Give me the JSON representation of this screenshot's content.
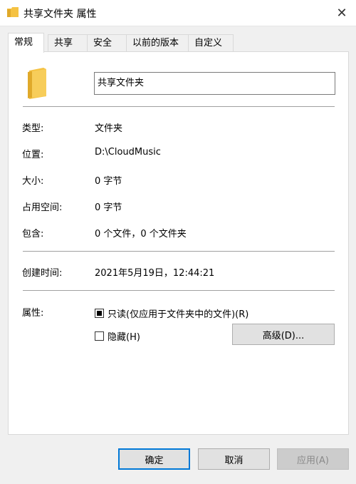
{
  "window": {
    "title": "共享文件夹 属性",
    "close_symbol": "✕"
  },
  "tabs": [
    {
      "label": "常规",
      "active": true
    },
    {
      "label": "共享"
    },
    {
      "label": "安全"
    },
    {
      "label": "以前的版本"
    },
    {
      "label": "自定义"
    }
  ],
  "general": {
    "folder_name": "共享文件夹",
    "rows": [
      {
        "label": "类型:",
        "value": "文件夹"
      },
      {
        "label": "位置:",
        "value": "D:\\CloudMusic"
      },
      {
        "label": "大小:",
        "value": "0 字节"
      },
      {
        "label": "占用空间:",
        "value": "0 字节"
      },
      {
        "label": "包含:",
        "value": "0 个文件，0 个文件夹"
      }
    ],
    "created": {
      "label": "创建时间:",
      "value": "2021年5月19日，12:44:21"
    },
    "attributes": {
      "label": "属性:",
      "readonly_label": "只读(仅应用于文件夹中的文件)(R)",
      "readonly_state": "indeterminate",
      "hidden_label": "隐藏(H)",
      "hidden_checked": false,
      "advanced_button": "高级(D)..."
    }
  },
  "footer": {
    "ok": "确定",
    "cancel": "取消",
    "apply": "应用(A)"
  },
  "colors": {
    "folder": "#f5c242",
    "folder_dark": "#e0a92a",
    "accent": "#0078d7"
  }
}
